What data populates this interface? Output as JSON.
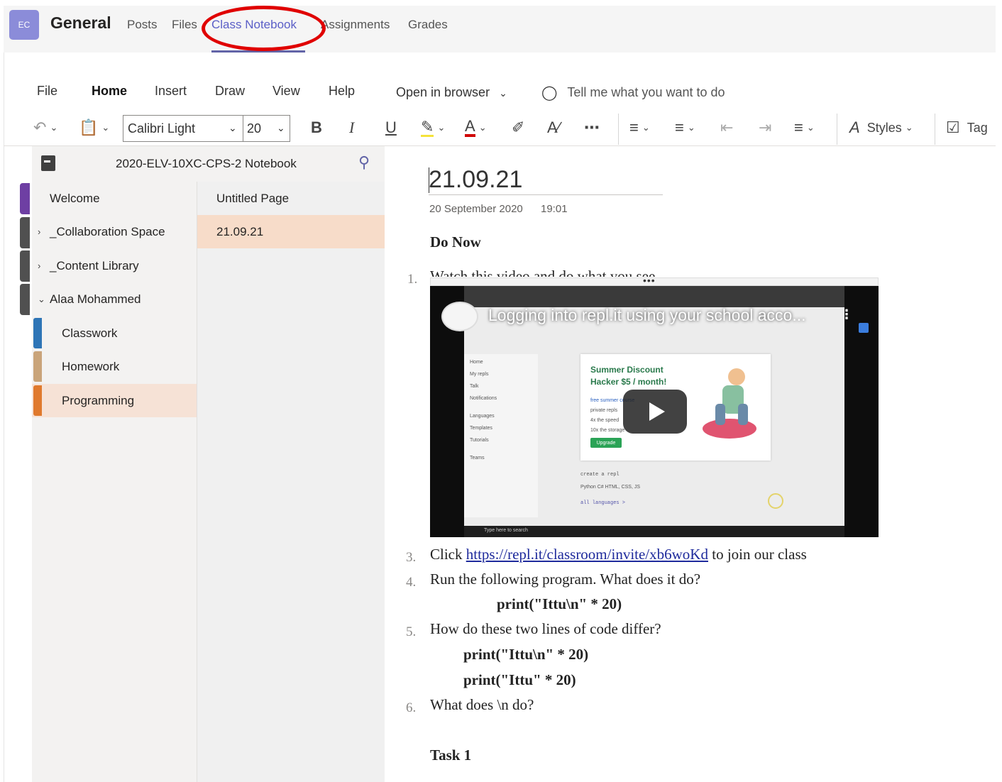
{
  "teams": {
    "avatar": "EC",
    "channel": "General",
    "tabs": [
      {
        "label": "Posts",
        "active": false
      },
      {
        "label": "Files",
        "active": false
      },
      {
        "label": "Class Notebook",
        "active": true
      },
      {
        "label": "Assignments",
        "active": false
      },
      {
        "label": "Grades",
        "active": false
      }
    ]
  },
  "ribbon": {
    "menu": [
      "File",
      "Home",
      "Insert",
      "Draw",
      "View",
      "Help"
    ],
    "active_menu": "Home",
    "open_in_browser": "Open in browser",
    "tell_me": "Tell me what you want to do",
    "font_name": "Calibri Light",
    "font_size": "20",
    "bold": "B",
    "italic": "I",
    "underline": "U",
    "styles": "Styles",
    "tag": "Tag"
  },
  "notebook": {
    "title": "2020-ELV-10XC-CPS-2 Notebook",
    "sections": [
      {
        "label": "Welcome",
        "color": "#7d3c98"
      },
      {
        "label": "_Collaboration Space",
        "collapsed": true
      },
      {
        "label": "_Content Library",
        "collapsed": true
      },
      {
        "label": "Alaa Mohammed",
        "expanded": true
      },
      {
        "label": "Classwork",
        "color": "#2e75b6"
      },
      {
        "label": "Homework",
        "color": "#c9a47a"
      },
      {
        "label": "Programming",
        "color": "#e07a2e",
        "selected": true
      }
    ],
    "pages": [
      {
        "label": "Untitled Page",
        "selected": false
      },
      {
        "label": "21.09.21",
        "selected": true
      }
    ]
  },
  "page": {
    "title": "21.09.21",
    "date": "20 September 2020",
    "time": "19:01",
    "heading": "Do Now",
    "item1_num": "1.",
    "item1": "Watch this video and do what you see",
    "video": {
      "title": "Logging into repl.it using your school acco...",
      "card_title_line1": "Summer Discount",
      "card_title_line2": "Hacker $5 / month!",
      "card_lines": [
        "free summer course",
        "private repls",
        "4x the speed",
        "10x the storage"
      ],
      "upgrade": "Upgrade",
      "create": "create a repl",
      "langs": "Python   C#   HTML, CSS, JS",
      "all": "all languages >",
      "side_items": [
        "Home",
        "My repls",
        "Talk",
        "Notifications",
        "Languages",
        "Templates",
        "Tutorials",
        "Teams"
      ],
      "search_taskbar": "Type here to search"
    },
    "item3_num": "3.",
    "item3_pre": "Click ",
    "item3_link": "https://repl.it/classroom/invite/xb6woKd",
    "item3_post": " to join our class",
    "item4_num": "4.",
    "item4": "Run the following program. What does it do?",
    "code1": "print(\"Ittu\\n\" * 20)",
    "item5_num": "5.",
    "item5": "How do these two lines of code differ?",
    "code2": "print(\"Ittu\\n\" * 20)",
    "code3": "print(\"Ittu\" * 20)",
    "item6_num": "6.",
    "item6": "What does \\n do?",
    "task": "Task 1"
  },
  "colors": {
    "accent": "#6264a7",
    "annotation_circle": "#e00000",
    "selected_section": "#f6e2d6",
    "selected_page": "#f7dcc9"
  }
}
